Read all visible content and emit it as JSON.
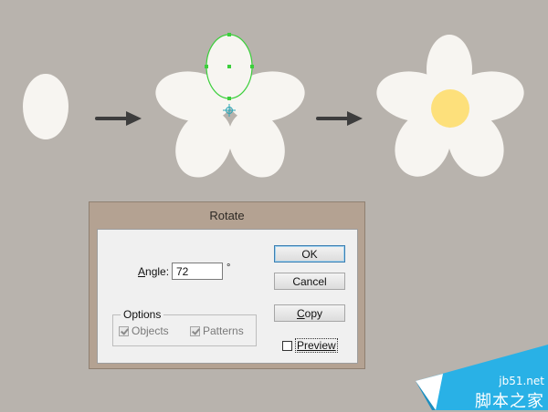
{
  "colors": {
    "background": "#b8b3ad",
    "petal": "#f7f5f1",
    "center": "#fde07b",
    "selection": "#3ccf3c",
    "arrow": "#3d3d3d",
    "watermark": "#29b1e6"
  },
  "artwork": {
    "icons": [
      "single-petal",
      "arrow-right-icon",
      "rotated-petals",
      "arrow-right-icon",
      "finished-flower"
    ]
  },
  "dialog": {
    "title": "Rotate",
    "angle": {
      "label_prefix": "",
      "label_accel": "A",
      "label_rest": "ngle:",
      "value": "72",
      "unit": "°"
    },
    "options": {
      "legend": "Options",
      "objects": {
        "label": "Objects",
        "checked": true,
        "enabled": false
      },
      "patterns": {
        "label": "Patterns",
        "checked": true,
        "enabled": false
      }
    },
    "buttons": {
      "ok": "OK",
      "cancel": "Cancel",
      "copy_accel": "C",
      "copy_rest": "opy"
    },
    "preview": {
      "label_accel": "P",
      "label_rest": "review",
      "checked": false
    }
  },
  "watermark": {
    "domain": "jb51.net",
    "name": "脚本之家"
  }
}
